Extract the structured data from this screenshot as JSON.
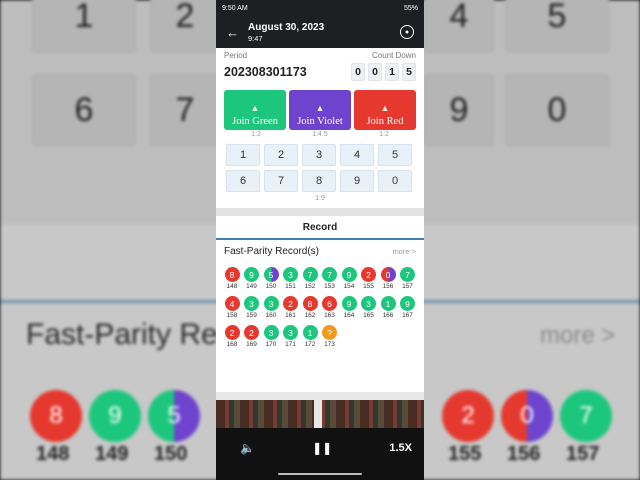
{
  "status_bar": {
    "time": "9:50 AM",
    "battery": "55%"
  },
  "header": {
    "date": "August 30, 2023",
    "time": "9:47"
  },
  "game": {
    "period_label": "Period",
    "countdown_label": "Count Down",
    "period": "202308301173",
    "countdown_digits": [
      "0",
      "0",
      "1",
      "5"
    ],
    "join_buttons": [
      {
        "label": "Join Green",
        "ratio": "1:2",
        "color": "#1cc77d"
      },
      {
        "label": "Join Violet",
        "ratio": "1:4.5",
        "color": "#6e44cf"
      },
      {
        "label": "Join Red",
        "ratio": "1:2",
        "color": "#e5392f"
      }
    ],
    "numbers": [
      "1",
      "2",
      "3",
      "4",
      "5",
      "6",
      "7",
      "8",
      "9",
      "0"
    ],
    "number_ratio": "1:9"
  },
  "record": {
    "tab_label": "Record",
    "title": "Fast-Parity Record(s)",
    "more": "more >",
    "rows": [
      [
        {
          "n": "8",
          "p": "148",
          "c": "red"
        },
        {
          "n": "9",
          "p": "149",
          "c": "green"
        },
        {
          "n": "5",
          "p": "150",
          "c": "gv"
        },
        {
          "n": "3",
          "p": "151",
          "c": "green"
        },
        {
          "n": "7",
          "p": "152",
          "c": "green"
        },
        {
          "n": "7",
          "p": "153",
          "c": "green"
        },
        {
          "n": "9",
          "p": "154",
          "c": "green"
        },
        {
          "n": "2",
          "p": "155",
          "c": "red"
        },
        {
          "n": "0",
          "p": "156",
          "c": "rv"
        },
        {
          "n": "7",
          "p": "157",
          "c": "green"
        }
      ],
      [
        {
          "n": "4",
          "p": "158",
          "c": "red"
        },
        {
          "n": "3",
          "p": "159",
          "c": "green"
        },
        {
          "n": "3",
          "p": "160",
          "c": "green"
        },
        {
          "n": "2",
          "p": "161",
          "c": "red"
        },
        {
          "n": "8",
          "p": "162",
          "c": "red"
        },
        {
          "n": "6",
          "p": "163",
          "c": "red"
        },
        {
          "n": "9",
          "p": "164",
          "c": "green"
        },
        {
          "n": "3",
          "p": "165",
          "c": "green"
        },
        {
          "n": "1",
          "p": "166",
          "c": "green"
        },
        {
          "n": "9",
          "p": "167",
          "c": "green"
        }
      ],
      [
        {
          "n": "2",
          "p": "168",
          "c": "red"
        },
        {
          "n": "2",
          "p": "169",
          "c": "red"
        },
        {
          "n": "3",
          "p": "170",
          "c": "green"
        },
        {
          "n": "3",
          "p": "171",
          "c": "green"
        },
        {
          "n": "1",
          "p": "172",
          "c": "green"
        },
        {
          "n": "?",
          "p": "173",
          "c": "orange"
        }
      ]
    ]
  },
  "player": {
    "speed": "1.5X",
    "volume_icon": "speaker-icon",
    "pause_icon": "pause-icon"
  },
  "background": {
    "top_numbers": [
      "1",
      "2",
      "4",
      "5",
      "6",
      "7",
      "9",
      "0"
    ],
    "title": "Fast-Parity Rec",
    "more": "more >",
    "balls": [
      {
        "n": "8",
        "p": "148",
        "c": "red"
      },
      {
        "n": "9",
        "p": "149",
        "c": "green"
      },
      {
        "n": "5",
        "p": "150",
        "c": "gv"
      },
      {
        "n": "2",
        "p": "155",
        "c": "red"
      },
      {
        "n": "0",
        "p": "156",
        "c": "rv"
      },
      {
        "n": "7",
        "p": "157",
        "c": "green"
      }
    ]
  }
}
